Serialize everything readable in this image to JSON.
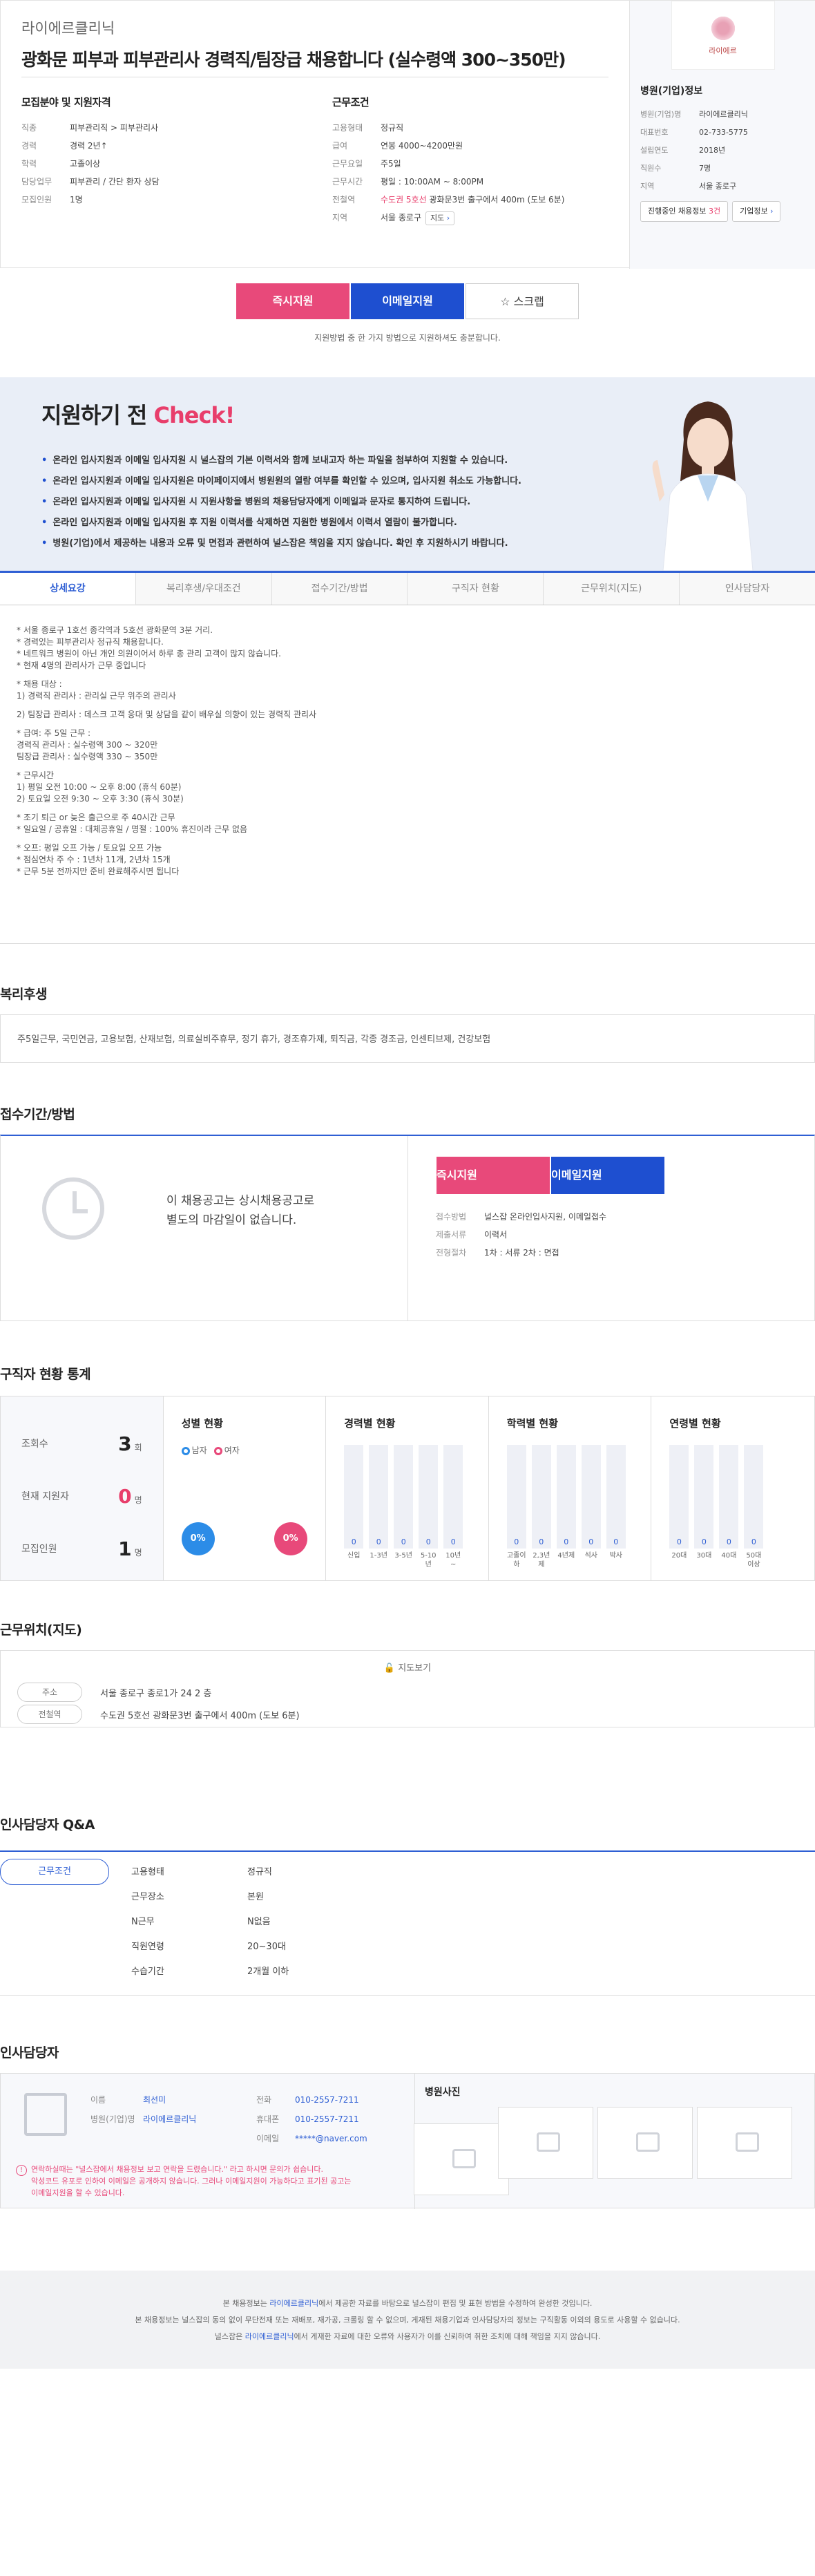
{
  "header": {
    "company": "라이에르클리닉",
    "title": "광화문 피부과 피부관리사 경력직/팀장급 채용합니다 (실수령액 300~350만)",
    "left": {
      "heading": "모집분야 및 지원자격",
      "rows": [
        {
          "k": "직종",
          "v": "피부관리직 > 피부관리사"
        },
        {
          "k": "경력",
          "v": "경력 2년↑"
        },
        {
          "k": "학력",
          "v": "고졸이상"
        },
        {
          "k": "담당업무",
          "v": "피부관리 / 간단 환자 상담"
        },
        {
          "k": "모집인원",
          "v": "1명"
        }
      ]
    },
    "right": {
      "heading": "근무조건",
      "rows": [
        {
          "k": "고용형태",
          "v": "정규직"
        },
        {
          "k": "급여",
          "v": "연봉 4000~4200만원"
        },
        {
          "k": "근무요일",
          "v": "주5일"
        },
        {
          "k": "근무시간",
          "v": "평일 : 10:00AM ~ 8:00PM"
        },
        {
          "k": "전철역",
          "v_pink": "수도권 5호선",
          "v": "광화문3번 출구에서 400m (도보 6분)"
        },
        {
          "k": "지역",
          "v": "서울 종로구",
          "btn": "지도"
        }
      ]
    }
  },
  "side": {
    "logo_text": "라이에르",
    "heading": "병원(기업)정보",
    "rows": [
      {
        "k": "병원(기업)명",
        "v": "라이에르클리닉"
      },
      {
        "k": "대표번호",
        "v": "02-733-5775"
      },
      {
        "k": "설립연도",
        "v": "2018년"
      },
      {
        "k": "직원수",
        "v": "7명"
      },
      {
        "k": "지역",
        "v": "서울 종로구"
      }
    ],
    "btn_jobs": "진행중인 채용정보",
    "btn_jobs_count": "3건",
    "btn_company": "기업정보"
  },
  "apply": {
    "instant": "즉시지원",
    "email": "이메일지원",
    "scrap": "스크랩",
    "note": "지원방법 중 한 가지 방법으로 지원하셔도 충분합니다."
  },
  "check": {
    "title_a": "지원하기 전 ",
    "title_b": "Check!",
    "items": [
      "온라인 입사지원과 이메일 입사지원 시 널스잡의 기본 이력서와 함께 보내고자 하는 파일을 첨부하여 지원할 수 있습니다.",
      "온라인 입사지원과 이메일 입사지원은 마이페이지에서 병원원의 열람 여부를 확인할 수 있으며, 입사지원 취소도 가능합니다.",
      "온라인 입사지원과 이메일 입사지원 시 지원사항을 병원의 채용담당자에게 이메일과 문자로 통지하여 드립니다.",
      "온라인 입사지원과 이메일 입사지원 후 지원 이력서를 삭제하면 지원한 병원에서 이력서 열람이 불가합니다.",
      "병원(기업)에서 제공하는 내용과 오류 및 면접과 관련하여 널스잡은 책임을 지지 않습니다. 확인 후 지원하시기 바랍니다."
    ]
  },
  "tabs": [
    "상세요강",
    "복리후생/우대조건",
    "접수기간/방법",
    "구직자 현황",
    "근무위치(지도)",
    "인사담당자"
  ],
  "detail": [
    "* 서울 종로구 1호선 종각역과 5호선 광화문역 3분 거리.\n* 경력있는 피부관리사 정규직 채용합니다.\n* 네트워크 병원이 아닌 개인 의원이어서 하루 총 관리 고객이 많지 않습니다.\n* 현재 4명의 관리사가 근무 중입니다",
    "* 채용 대상 :\n1) 경력직 관리사 : 관리실 근무 위주의 관리사",
    "2) 팀장급 관리사 : 데스크 고객 응대 및 상담을 같이 배우실 의향이 있는 경력직 관리사",
    "* 급여: 주 5일 근무 :\n 경력직 관리사 : 실수령액 300 ~ 320만\n 팀장급 관리사 : 실수령액 330 ~ 350만",
    "* 근무시간\n 1) 평일 오전 10:00 ~ 오후 8:00 (휴식 60분)\n 2) 토요일 오전 9:30 ~ 오후 3:30 (휴식 30분)",
    "* 조기 퇴근 or 늦은 출근으로 주 40시간 근무\n* 일요일 / 공휴일 : 대체공휴일 / 명절 : 100% 휴진이라 근무 없음",
    "* 오프: 평일 오프 가능 / 토요일 오프 가능\n* 점심연차 주 수 : 1년차 11개, 2년차 15개\n* 근무 5분 전까지만 준비 완료해주시면 됩니다"
  ],
  "welfare": {
    "title": "복리후생",
    "text": "주5일근무, 국민연금, 고용보험, 산재보험, 의료실비주휴무, 정기 휴가, 경조휴가제, 퇴직금, 각종 경조금, 인센티브제, 건강보험"
  },
  "period": {
    "title": "접수기간/방법",
    "text1": "이 채용공고는 상시채용공고로",
    "text2": "별도의 마감일이 없습니다.",
    "rows": [
      {
        "k": "접수방법",
        "v": "널스잡 온라인입사지원, 이메일접수"
      },
      {
        "k": "제출서류",
        "v": "이력서"
      },
      {
        "k": "전형절차",
        "v": "1차 : 서류    2차 : 면접"
      }
    ]
  },
  "stats": {
    "title": "구직자 현황 통계",
    "views_label": "조회수",
    "views": "3",
    "views_unit": "회",
    "applicants_label": "현재 지원자",
    "applicants": "0",
    "applicants_unit": "명",
    "recruit_label": "모집인원",
    "recruit": "1",
    "recruit_unit": "명",
    "gender_title": "성별 현황",
    "male": "남자",
    "female": "여자",
    "male_pct": "0%",
    "female_pct": "0%",
    "career_title": "경력별 현황",
    "career": [
      {
        "l": "신입",
        "v": "0"
      },
      {
        "l": "1-3년",
        "v": "0"
      },
      {
        "l": "3-5년",
        "v": "0"
      },
      {
        "l": "5-10년",
        "v": "0"
      },
      {
        "l": "10년~",
        "v": "0"
      }
    ],
    "edu_title": "학력별 현황",
    "edu": [
      {
        "l": "고졸이하",
        "v": "0"
      },
      {
        "l": "2,3년제",
        "v": "0"
      },
      {
        "l": "4년제",
        "v": "0"
      },
      {
        "l": "석사",
        "v": "0"
      },
      {
        "l": "박사",
        "v": "0"
      }
    ],
    "age_title": "연령별 현황",
    "age": [
      {
        "l": "20대",
        "v": "0"
      },
      {
        "l": "30대",
        "v": "0"
      },
      {
        "l": "40대",
        "v": "0"
      },
      {
        "l": "50대이상",
        "v": "0"
      }
    ]
  },
  "location": {
    "title": "근무위치(지도)",
    "map_btn": "지도보기",
    "addr_label": "주소",
    "addr": "서울 종로구 종로1가 24 2 층",
    "subway_label": "전철역",
    "subway": "수도권 5호선 광화문3번 출구에서 400m (도보 6분)"
  },
  "qa": {
    "title": "인사담당자 Q&A",
    "tab": "근무조건",
    "rows": [
      {
        "k": "고용형태",
        "v": "정규직"
      },
      {
        "k": "근무장소",
        "v": "본원"
      },
      {
        "k": "N근무",
        "v": "N없음"
      },
      {
        "k": "직원연령",
        "v": "20~30대"
      },
      {
        "k": "수습기간",
        "v": "2개월 이하"
      }
    ]
  },
  "manager": {
    "title": "인사담당자",
    "name_label": "이름",
    "name": "최선미",
    "company_label": "병원(기업)명",
    "company": "라이에르클리닉",
    "phone_label": "전화",
    "phone": "010-2557-7211",
    "mobile_label": "휴대폰",
    "mobile": "010-2557-7211",
    "email_label": "이메일",
    "email": "*****@naver.com",
    "warn1": "연락하실때는 \"널스잡에서 채용정보 보고 연락을 드렸습니다.\" 라고 하시면 문의가 쉽습니다.",
    "warn2": "악성코드 유포로 인하여 이메일은 공개하지 않습니다. 그러나 이메일지원이 가능하다고 표기된 공고는",
    "warn3": "이메일지원을 할 수 있습니다.",
    "photos_title": "병원사진"
  },
  "footer": {
    "l1a": "본 채용정보는 ",
    "l1b": "라이에르클리닉",
    "l1c": "에서 제공한 자료를 바탕으로 널스잡이 편집 및 표현 방법을 수정하여 완성한 것입니다.",
    "l2": "본 채용정보는 널스잡의 동의 없이 무단전재 또는 재배포, 재가공, 크롤링 할 수 없으며, 게재된 채용기업과 인사담당자의 정보는 구직활동 이외의 용도로 사용할 수 없습니다.",
    "l3a": "널스잡은 ",
    "l3b": "라이에르클리닉",
    "l3c": "에서 게재한 자료에 대한 오류와 사용자가 이를 신뢰하여 취한 조치에 대해 책임을 지지 않습니다."
  }
}
